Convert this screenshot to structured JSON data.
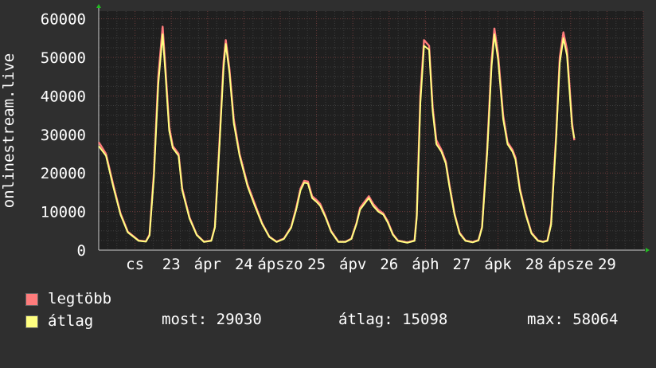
{
  "chart_data": {
    "type": "line",
    "ylabel": "onlinestream.live",
    "ylim": [
      0,
      62000
    ],
    "yticks": [
      0,
      10000,
      20000,
      30000,
      40000,
      50000,
      60000
    ],
    "xlim": [
      0,
      7.5
    ],
    "xticks": [
      {
        "x": 0.5,
        "label": "cs"
      },
      {
        "x": 1.0,
        "label": "23"
      },
      {
        "x": 1.5,
        "label": "ápr"
      },
      {
        "x": 2.0,
        "label": "24"
      },
      {
        "x": 2.5,
        "label": "ápszo"
      },
      {
        "x": 3.0,
        "label": "25"
      },
      {
        "x": 3.5,
        "label": "ápv"
      },
      {
        "x": 4.0,
        "label": "26"
      },
      {
        "x": 4.5,
        "label": "áph"
      },
      {
        "x": 5.0,
        "label": "27"
      },
      {
        "x": 5.5,
        "label": "ápk"
      },
      {
        "x": 6.0,
        "label": "28"
      },
      {
        "x": 6.5,
        "label": "ápsze"
      },
      {
        "x": 7.0,
        "label": "29"
      }
    ],
    "grid": true,
    "series": [
      {
        "name": "legtöbb",
        "color": "#ff7c7c",
        "points": [
          [
            0,
            28000
          ],
          [
            0.1,
            25000
          ],
          [
            0.2,
            17000
          ],
          [
            0.3,
            9500
          ],
          [
            0.4,
            4800
          ],
          [
            0.55,
            2500
          ],
          [
            0.65,
            2300
          ],
          [
            0.7,
            4000
          ],
          [
            0.76,
            20000
          ],
          [
            0.82,
            45000
          ],
          [
            0.88,
            58000
          ],
          [
            0.92,
            47000
          ],
          [
            0.97,
            32000
          ],
          [
            1.02,
            27000
          ],
          [
            1.1,
            25000
          ],
          [
            1.15,
            16000
          ],
          [
            1.25,
            8500
          ],
          [
            1.35,
            4000
          ],
          [
            1.45,
            2200
          ],
          [
            1.55,
            2500
          ],
          [
            1.6,
            6000
          ],
          [
            1.66,
            27000
          ],
          [
            1.72,
            49000
          ],
          [
            1.75,
            54500
          ],
          [
            1.8,
            47000
          ],
          [
            1.86,
            34000
          ],
          [
            1.94,
            25000
          ],
          [
            2.05,
            17000
          ],
          [
            2.15,
            12000
          ],
          [
            2.25,
            7000
          ],
          [
            2.35,
            3500
          ],
          [
            2.45,
            2200
          ],
          [
            2.55,
            3000
          ],
          [
            2.65,
            6000
          ],
          [
            2.72,
            11000
          ],
          [
            2.78,
            16000
          ],
          [
            2.83,
            18000
          ],
          [
            2.88,
            17800
          ],
          [
            2.94,
            14000
          ],
          [
            3.0,
            13000
          ],
          [
            3.05,
            12000
          ],
          [
            3.12,
            9000
          ],
          [
            3.2,
            5000
          ],
          [
            3.3,
            2200
          ],
          [
            3.4,
            2200
          ],
          [
            3.48,
            3000
          ],
          [
            3.55,
            7000
          ],
          [
            3.6,
            11000
          ],
          [
            3.66,
            12500
          ],
          [
            3.72,
            14000
          ],
          [
            3.78,
            12000
          ],
          [
            3.85,
            10500
          ],
          [
            3.92,
            9500
          ],
          [
            3.98,
            7500
          ],
          [
            4.05,
            4200
          ],
          [
            4.12,
            2500
          ],
          [
            4.25,
            2000
          ],
          [
            4.35,
            2500
          ],
          [
            4.38,
            9000
          ],
          [
            4.43,
            40000
          ],
          [
            4.48,
            54500
          ],
          [
            4.55,
            53000
          ],
          [
            4.6,
            37000
          ],
          [
            4.65,
            28500
          ],
          [
            4.72,
            26000
          ],
          [
            4.78,
            23000
          ],
          [
            4.83,
            17000
          ],
          [
            4.9,
            9500
          ],
          [
            4.97,
            4500
          ],
          [
            5.05,
            2500
          ],
          [
            5.15,
            2100
          ],
          [
            5.23,
            2600
          ],
          [
            5.28,
            6000
          ],
          [
            5.35,
            26000
          ],
          [
            5.41,
            49000
          ],
          [
            5.45,
            57500
          ],
          [
            5.5,
            51000
          ],
          [
            5.57,
            35000
          ],
          [
            5.63,
            28000
          ],
          [
            5.7,
            26000
          ],
          [
            5.74,
            24000
          ],
          [
            5.8,
            16000
          ],
          [
            5.88,
            9500
          ],
          [
            5.96,
            4500
          ],
          [
            6.05,
            2500
          ],
          [
            6.12,
            2200
          ],
          [
            6.18,
            2500
          ],
          [
            6.23,
            7000
          ],
          [
            6.3,
            30000
          ],
          [
            6.35,
            50000
          ],
          [
            6.4,
            56500
          ],
          [
            6.45,
            52000
          ],
          [
            6.52,
            33000
          ],
          [
            6.55,
            28500
          ]
        ]
      },
      {
        "name": "átlag",
        "color": "#ffff80",
        "points": [
          [
            0,
            27000
          ],
          [
            0.1,
            24500
          ],
          [
            0.2,
            16500
          ],
          [
            0.3,
            9200
          ],
          [
            0.4,
            4600
          ],
          [
            0.55,
            2400
          ],
          [
            0.65,
            2200
          ],
          [
            0.7,
            3800
          ],
          [
            0.76,
            19000
          ],
          [
            0.82,
            43000
          ],
          [
            0.88,
            56000
          ],
          [
            0.92,
            45500
          ],
          [
            0.97,
            31000
          ],
          [
            1.02,
            26500
          ],
          [
            1.1,
            24500
          ],
          [
            1.15,
            15500
          ],
          [
            1.25,
            8200
          ],
          [
            1.35,
            3900
          ],
          [
            1.45,
            2100
          ],
          [
            1.55,
            2400
          ],
          [
            1.6,
            5800
          ],
          [
            1.66,
            26000
          ],
          [
            1.72,
            47500
          ],
          [
            1.75,
            53500
          ],
          [
            1.8,
            46000
          ],
          [
            1.86,
            33000
          ],
          [
            1.94,
            24500
          ],
          [
            2.05,
            16500
          ],
          [
            2.15,
            11500
          ],
          [
            2.25,
            6800
          ],
          [
            2.35,
            3400
          ],
          [
            2.45,
            2100
          ],
          [
            2.55,
            2900
          ],
          [
            2.65,
            5800
          ],
          [
            2.72,
            10500
          ],
          [
            2.78,
            15500
          ],
          [
            2.83,
            17500
          ],
          [
            2.88,
            17300
          ],
          [
            2.94,
            13500
          ],
          [
            3.0,
            12500
          ],
          [
            3.05,
            11500
          ],
          [
            3.12,
            8700
          ],
          [
            3.2,
            4800
          ],
          [
            3.3,
            2100
          ],
          [
            3.4,
            2100
          ],
          [
            3.48,
            2900
          ],
          [
            3.55,
            6800
          ],
          [
            3.6,
            10500
          ],
          [
            3.66,
            12000
          ],
          [
            3.72,
            13500
          ],
          [
            3.78,
            11500
          ],
          [
            3.85,
            10000
          ],
          [
            3.92,
            9200
          ],
          [
            3.98,
            7200
          ],
          [
            4.05,
            4000
          ],
          [
            4.12,
            2400
          ],
          [
            4.25,
            1900
          ],
          [
            4.35,
            2400
          ],
          [
            4.38,
            8500
          ],
          [
            4.43,
            38000
          ],
          [
            4.48,
            53000
          ],
          [
            4.55,
            52000
          ],
          [
            4.6,
            36000
          ],
          [
            4.65,
            27500
          ],
          [
            4.72,
            25500
          ],
          [
            4.78,
            22500
          ],
          [
            4.83,
            16500
          ],
          [
            4.9,
            9200
          ],
          [
            4.97,
            4300
          ],
          [
            5.05,
            2400
          ],
          [
            5.15,
            2000
          ],
          [
            5.23,
            2500
          ],
          [
            5.28,
            5800
          ],
          [
            5.35,
            25000
          ],
          [
            5.41,
            47500
          ],
          [
            5.45,
            56000
          ],
          [
            5.5,
            49500
          ],
          [
            5.57,
            34000
          ],
          [
            5.63,
            27500
          ],
          [
            5.7,
            25500
          ],
          [
            5.74,
            23500
          ],
          [
            5.8,
            15500
          ],
          [
            5.88,
            9200
          ],
          [
            5.96,
            4300
          ],
          [
            6.05,
            2400
          ],
          [
            6.12,
            2100
          ],
          [
            6.18,
            2400
          ],
          [
            6.23,
            6500
          ],
          [
            6.3,
            29000
          ],
          [
            6.35,
            48500
          ],
          [
            6.4,
            55000
          ],
          [
            6.45,
            50500
          ],
          [
            6.52,
            32000
          ],
          [
            6.55,
            29030
          ]
        ]
      }
    ]
  },
  "legend": {
    "max_label": "legtöbb",
    "max_color": "#ff7c7c",
    "avg_label": "átlag",
    "avg_color": "#ffff80"
  },
  "stats": {
    "current": "most: 29030",
    "average": "átlag: 15098",
    "maximum": "max: 58064"
  }
}
